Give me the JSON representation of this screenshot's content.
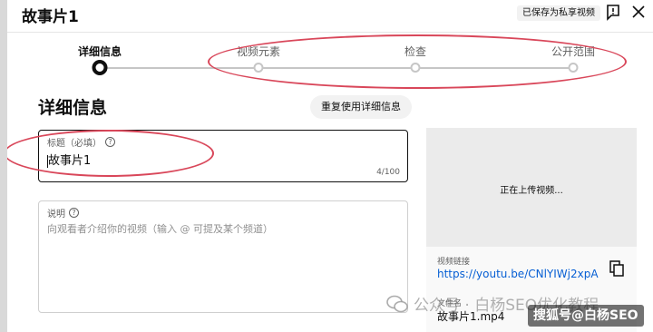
{
  "header": {
    "title": "故事片1",
    "saved_badge": "已保存为私享视频"
  },
  "steps": [
    {
      "label": "详细信息",
      "active": true
    },
    {
      "label": "视频元素",
      "active": false
    },
    {
      "label": "检查",
      "active": false
    },
    {
      "label": "公开范围",
      "active": false
    }
  ],
  "details": {
    "section_title": "详细信息",
    "reuse_button": "重复使用详细信息",
    "title_field": {
      "label": "标题（必填）",
      "value": "故事片1",
      "counter": "4/100"
    },
    "description_field": {
      "label": "说明",
      "placeholder": "向观看者介绍你的视频（输入 @ 可提及某个频道）"
    }
  },
  "preview": {
    "status": "正在上传视频...",
    "link_label": "视频链接",
    "link_value": "https://youtu.be/CNlYIWj2xpA",
    "file_label": "文件名",
    "file_value": "故事片1.mp4"
  },
  "watermark": {
    "text": "公众号 · 白杨SEO优化教程",
    "brand": "搜狐号@白杨SEO"
  },
  "colors": {
    "annotation": "#d9475a",
    "link": "#065fd4"
  }
}
